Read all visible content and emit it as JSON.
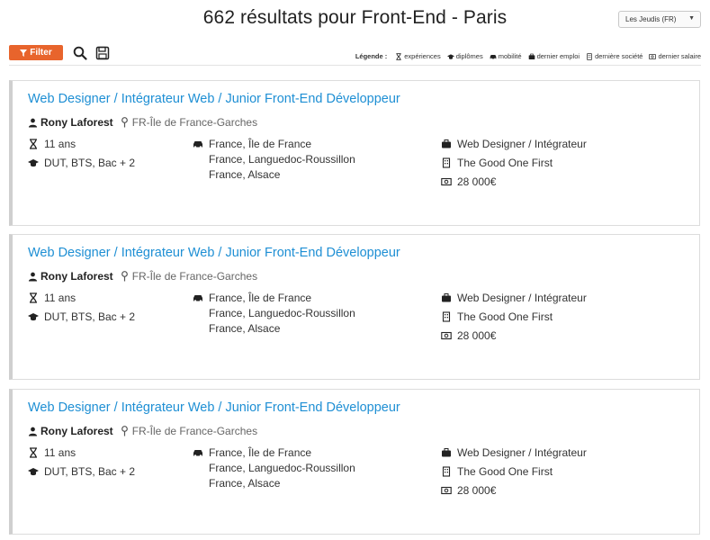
{
  "header": {
    "title": "662 résultats pour Front-End - Paris",
    "language_select": "Les Jeudis (FR)"
  },
  "toolbar": {
    "filter_label": "Filter",
    "legend": {
      "title": "Légende :",
      "items": [
        {
          "icon": "hourglass-icon",
          "label": "expériences"
        },
        {
          "icon": "graduation-cap-icon",
          "label": "diplômes"
        },
        {
          "icon": "car-icon",
          "label": "mobilité"
        },
        {
          "icon": "briefcase-icon",
          "label": "dernier emploi"
        },
        {
          "icon": "building-icon",
          "label": "dernière société"
        },
        {
          "icon": "money-icon",
          "label": "dernier salaire"
        }
      ]
    }
  },
  "results": [
    {
      "title": "Web Designer / Intégrateur Web / Junior Front-End Développeur",
      "name": "Rony Laforest",
      "location": "FR-Île de France-Garches",
      "experience": "11 ans",
      "diplomas": "DUT, BTS, Bac + 2",
      "mobility": [
        "France, Île de France",
        "France, Languedoc-Roussillon",
        "France, Alsace"
      ],
      "last_job": "Web Designer / Intégrateur",
      "last_company": "The Good One First",
      "last_salary": "28 000€"
    },
    {
      "title": "Web Designer / Intégrateur Web / Junior Front-End Développeur",
      "name": "Rony Laforest",
      "location": "FR-Île de France-Garches",
      "experience": "11 ans",
      "diplomas": "DUT, BTS, Bac + 2",
      "mobility": [
        "France, Île de France",
        "France, Languedoc-Roussillon",
        "France, Alsace"
      ],
      "last_job": "Web Designer / Intégrateur",
      "last_company": "The Good One First",
      "last_salary": "28 000€"
    },
    {
      "title": "Web Designer / Intégrateur Web / Junior Front-End Développeur",
      "name": "Rony Laforest",
      "location": "FR-Île de France-Garches",
      "experience": "11 ans",
      "diplomas": "DUT, BTS, Bac + 2",
      "mobility": [
        "France, Île de France",
        "France, Languedoc-Roussillon",
        "France, Alsace"
      ],
      "last_job": "Web Designer / Intégrateur",
      "last_company": "The Good One First",
      "last_salary": "28 000€"
    }
  ],
  "colors": {
    "accent": "#e8642c",
    "link": "#1e8fd4"
  }
}
